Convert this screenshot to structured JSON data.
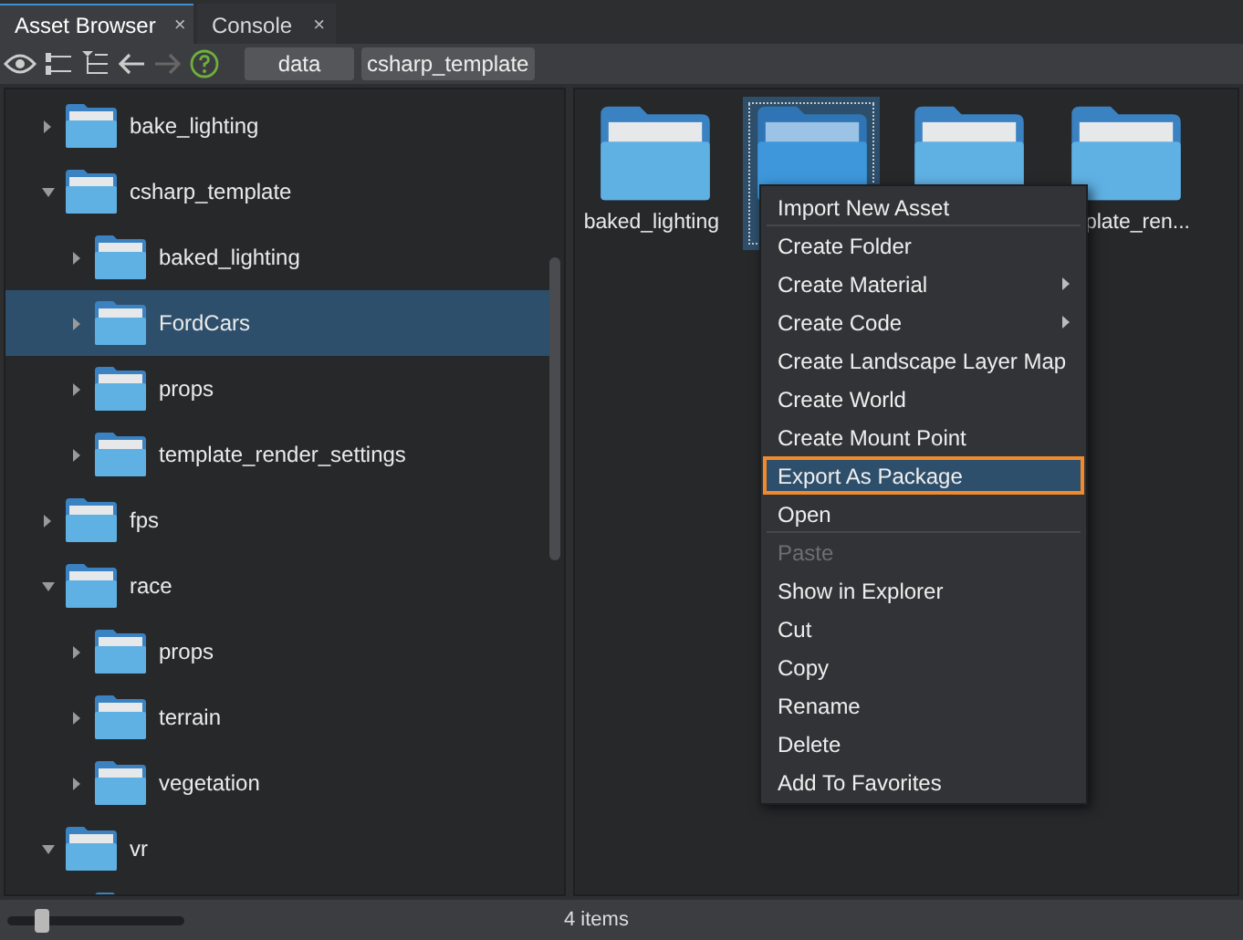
{
  "tabs": [
    {
      "label": "Asset Browser",
      "close": "×",
      "selected": true
    },
    {
      "label": "Console",
      "close": "×",
      "selected": false
    }
  ],
  "toolbar": {
    "back_disabled": false,
    "forward_disabled": true,
    "breadcrumbs": [
      "data",
      "csharp_template"
    ]
  },
  "tree": [
    {
      "label": "bake_lighting",
      "expanded": false,
      "selected": false
    },
    {
      "label": "csharp_template",
      "expanded": true,
      "selected": false,
      "children": [
        {
          "label": "baked_lighting",
          "expanded": false,
          "selected": false
        },
        {
          "label": "FordCars",
          "expanded": false,
          "selected": true
        },
        {
          "label": "props",
          "expanded": false,
          "selected": false
        },
        {
          "label": "template_render_settings",
          "expanded": false,
          "selected": false
        }
      ]
    },
    {
      "label": "fps",
      "expanded": false,
      "selected": false
    },
    {
      "label": "race",
      "expanded": true,
      "selected": false,
      "children": [
        {
          "label": "props",
          "expanded": false,
          "selected": false
        },
        {
          "label": "terrain",
          "expanded": false,
          "selected": false
        },
        {
          "label": "vegetation",
          "expanded": false,
          "selected": false
        }
      ]
    },
    {
      "label": "vr",
      "expanded": true,
      "selected": false,
      "children": [
        {
          "selected": false
        }
      ]
    }
  ],
  "grid": [
    {
      "label": "baked_lighting",
      "selected": false
    },
    {
      "selected": true
    },
    {
      "selected": false
    },
    {
      "label": "plate_ren...",
      "selected": false
    }
  ],
  "context_menu": [
    {
      "label": "Import New Asset",
      "separator_after": true,
      "submenu": false,
      "disabled": false,
      "selected": false
    },
    {
      "label": "Create Folder",
      "separator_after": false,
      "submenu": false,
      "disabled": false,
      "selected": false
    },
    {
      "label": "Create Material",
      "separator_after": false,
      "submenu": true,
      "disabled": false,
      "selected": false
    },
    {
      "label": "Create Code",
      "separator_after": false,
      "submenu": true,
      "disabled": false,
      "selected": false
    },
    {
      "label": "Create Landscape Layer Map",
      "separator_after": false,
      "submenu": false,
      "disabled": false,
      "selected": false
    },
    {
      "label": "Create World",
      "separator_after": false,
      "submenu": false,
      "disabled": false,
      "selected": false
    },
    {
      "label": "Create Mount Point",
      "separator_after": false,
      "submenu": false,
      "disabled": false,
      "selected": false
    },
    {
      "label": "Export As Package",
      "separator_after": false,
      "submenu": false,
      "disabled": false,
      "selected": true
    },
    {
      "label": "Open",
      "separator_after": true,
      "submenu": false,
      "disabled": false,
      "selected": false
    },
    {
      "label": "Paste",
      "separator_after": false,
      "submenu": false,
      "disabled": true,
      "selected": false
    },
    {
      "label": "Show in Explorer",
      "separator_after": false,
      "submenu": false,
      "disabled": false,
      "selected": false
    },
    {
      "label": "Cut",
      "separator_after": false,
      "submenu": false,
      "disabled": false,
      "selected": false
    },
    {
      "label": "Copy",
      "separator_after": false,
      "submenu": false,
      "disabled": false,
      "selected": false
    },
    {
      "label": "Rename",
      "separator_after": false,
      "submenu": false,
      "disabled": false,
      "selected": false
    },
    {
      "label": "Delete",
      "separator_after": false,
      "submenu": false,
      "disabled": false,
      "selected": false
    },
    {
      "label": "Add To Favorites",
      "separator_after": false,
      "submenu": false,
      "disabled": false,
      "selected": false
    }
  ],
  "status_bar": {
    "zoom": {
      "level": 0.2
    },
    "count": "4 items"
  }
}
